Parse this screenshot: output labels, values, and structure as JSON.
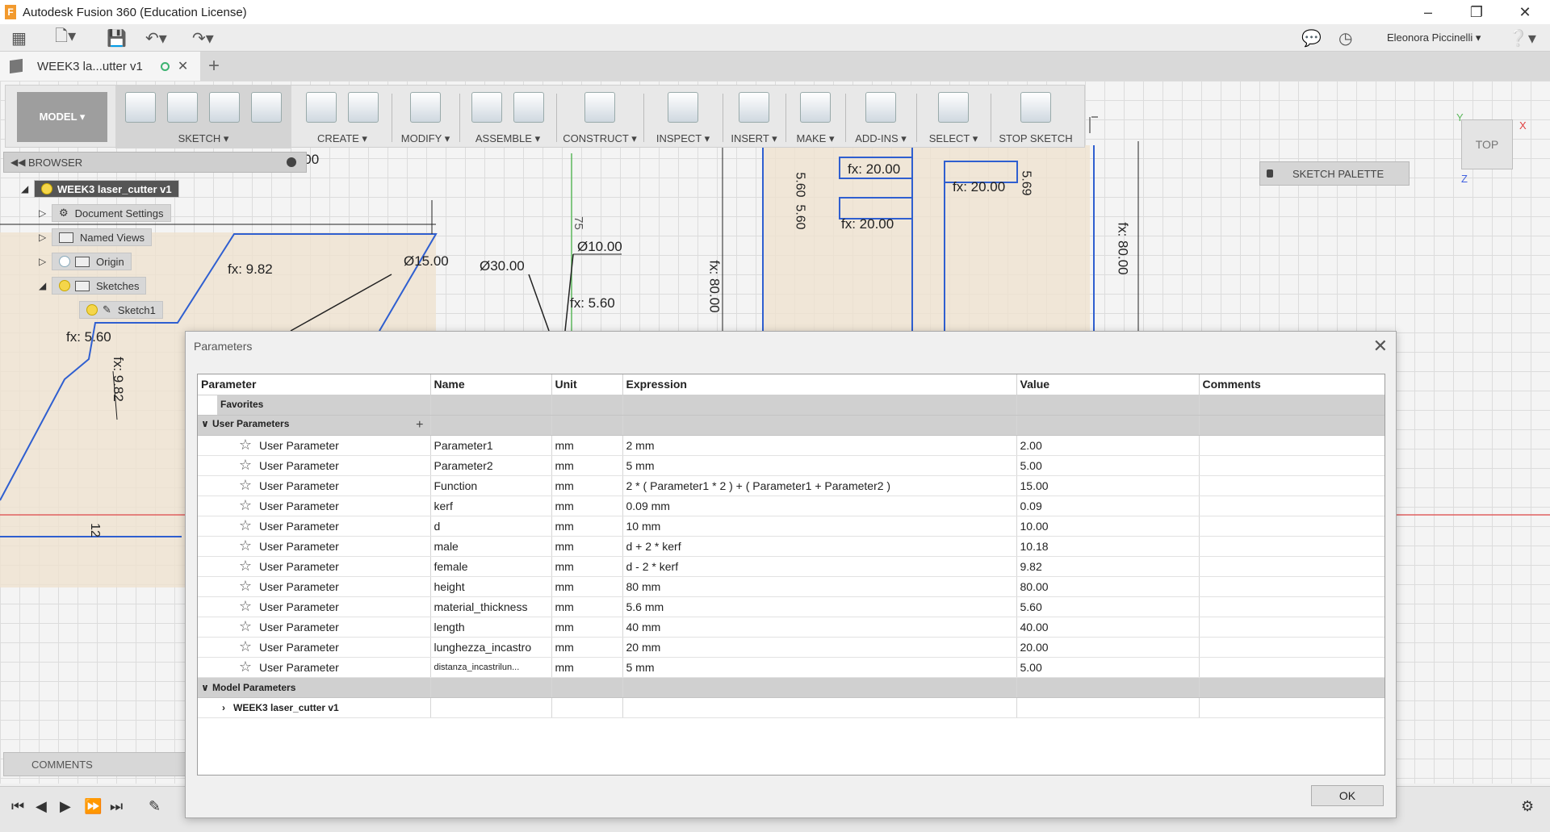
{
  "window": {
    "title": "Autodesk Fusion 360 (Education License)"
  },
  "quick_access": {
    "user_name": "Eleonora Piccinelli ▾"
  },
  "tab": {
    "label": "WEEK3 la...utter v1"
  },
  "toolbar": {
    "workspace": "MODEL ▾",
    "groups": [
      {
        "label": "SKETCH ▾"
      },
      {
        "label": "CREATE ▾"
      },
      {
        "label": "MODIFY ▾"
      },
      {
        "label": "ASSEMBLE ▾"
      },
      {
        "label": "CONSTRUCT ▾"
      },
      {
        "label": "INSPECT ▾"
      },
      {
        "label": "INSERT ▾"
      },
      {
        "label": "MAKE ▾"
      },
      {
        "label": "ADD-INS ▾"
      },
      {
        "label": "SELECT ▾"
      },
      {
        "label": "STOP SKETCH"
      }
    ]
  },
  "browser": {
    "title": "BROWSER",
    "root": "WEEK3 laser_cutter v1",
    "items": [
      "Document Settings",
      "Named Views",
      "Origin",
      "Sketches",
      "Sketch1"
    ]
  },
  "comments": {
    "label": "COMMENTS"
  },
  "sketch_palette": {
    "label": "SKETCH PALETTE"
  },
  "viewcube": {
    "face": "TOP",
    "axis_y": "Y",
    "axis_x": "X",
    "axis_z": "Z"
  },
  "dimensions": {
    "d1": "fx: 80.00",
    "d2": "Ø15.00",
    "d3": "Ø30.00",
    "d4": "Ø10.00",
    "d5": "fx: 9.82",
    "d6": "fx: 5.60",
    "d7": "fx: 5.60",
    "d8": "fx: 9.82",
    "d9": "fx: 20.00",
    "d10": "fx: 20.00",
    "d11": "fx: 20.00",
    "d12": "fx: 80.00",
    "d13": "fx: 80.00",
    "d14": "75",
    "d15": "5.60",
    "d16": "5.60",
    "d17": "5.69",
    "d18": "12"
  },
  "dialog": {
    "title": "Parameters",
    "ok_label": "OK",
    "columns": [
      "Parameter",
      "Name",
      "Unit",
      "Expression",
      "Value",
      "Comments"
    ],
    "groups": {
      "favorites": "Favorites",
      "user": "User Parameters",
      "model": "Model Parameters",
      "model_child": "WEEK3 laser_cutter v1"
    },
    "rows": [
      {
        "type": "User Parameter",
        "name": "Parameter1",
        "unit": "mm",
        "expression": "2 mm",
        "value": "2.00",
        "comment": ""
      },
      {
        "type": "User Parameter",
        "name": "Parameter2",
        "unit": "mm",
        "expression": "5 mm",
        "value": "5.00",
        "comment": ""
      },
      {
        "type": "User Parameter",
        "name": "Function",
        "unit": "mm",
        "expression": "2 * ( Parameter1 * 2 ) + ( Parameter1 + Parameter2 )",
        "value": "15.00",
        "comment": ""
      },
      {
        "type": "User Parameter",
        "name": "kerf",
        "unit": "mm",
        "expression": "0.09 mm",
        "value": "0.09",
        "comment": ""
      },
      {
        "type": "User Parameter",
        "name": "d",
        "unit": "mm",
        "expression": "10 mm",
        "value": "10.00",
        "comment": ""
      },
      {
        "type": "User Parameter",
        "name": "male",
        "unit": "mm",
        "expression": "d + 2 * kerf",
        "value": "10.18",
        "comment": ""
      },
      {
        "type": "User Parameter",
        "name": "female",
        "unit": "mm",
        "expression": "d - 2 * kerf",
        "value": "9.82",
        "comment": ""
      },
      {
        "type": "User Parameter",
        "name": "height",
        "unit": "mm",
        "expression": "80 mm",
        "value": "80.00",
        "comment": ""
      },
      {
        "type": "User Parameter",
        "name": "material_thickness",
        "unit": "mm",
        "expression": "5.6 mm",
        "value": "5.60",
        "comment": ""
      },
      {
        "type": "User Parameter",
        "name": "length",
        "unit": "mm",
        "expression": "40 mm",
        "value": "40.00",
        "comment": ""
      },
      {
        "type": "User Parameter",
        "name": "lunghezza_incastro",
        "unit": "mm",
        "expression": "20 mm",
        "value": "20.00",
        "comment": ""
      },
      {
        "type": "User Parameter",
        "name": "distanza_incastrilun...",
        "unit": "mm",
        "expression": "5 mm",
        "value": "5.00",
        "comment": ""
      }
    ]
  }
}
